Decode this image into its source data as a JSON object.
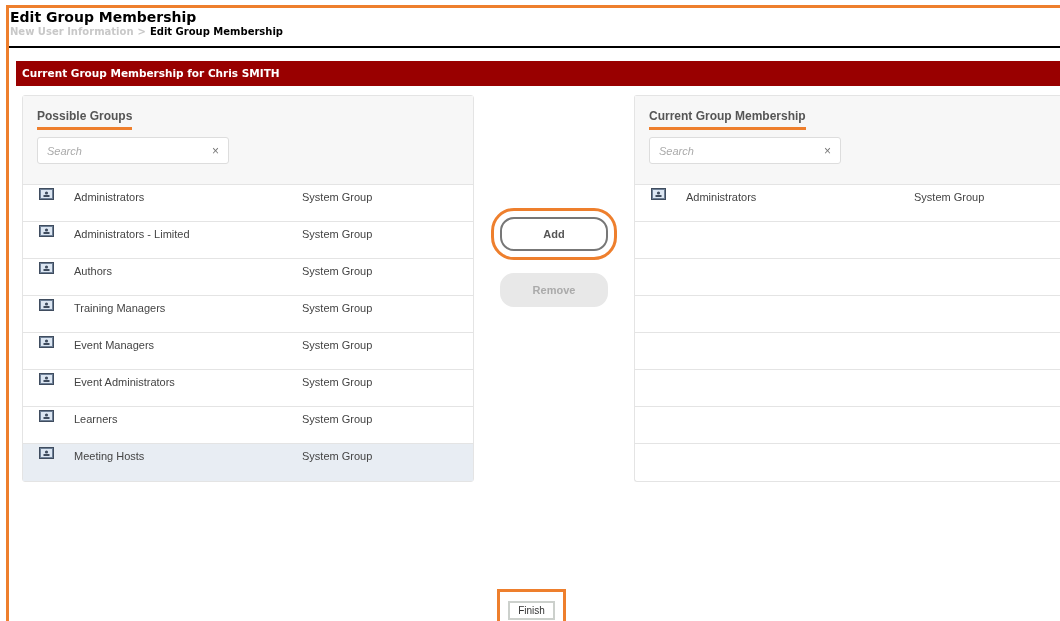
{
  "page": {
    "title": "Edit Group Membership",
    "breadcrumb": [
      {
        "label": "New User Information",
        "current": false
      },
      {
        "label": ">",
        "current": false
      },
      {
        "label": "Edit Group Membership",
        "current": true
      }
    ]
  },
  "banner": "Current Group Membership for Chris SMITH",
  "possible_groups": {
    "title": "Possible Groups",
    "underlined": true,
    "search": {
      "placeholder": "Search",
      "clear": "×"
    },
    "rows": [
      {
        "name": "Administrators",
        "type": "System Group",
        "selected": false
      },
      {
        "name": "Administrators - Limited",
        "type": "System Group",
        "selected": false
      },
      {
        "name": "Authors",
        "type": "System Group",
        "selected": false
      },
      {
        "name": "Training Managers",
        "type": "System Group",
        "selected": false
      },
      {
        "name": "Event Managers",
        "type": "System Group",
        "selected": false
      },
      {
        "name": "Event Administrators",
        "type": "System Group",
        "selected": false
      },
      {
        "name": "Learners",
        "type": "System Group",
        "selected": false
      },
      {
        "name": "Meeting Hosts",
        "type": "System Group",
        "selected": true
      }
    ]
  },
  "actions": [
    {
      "label": "Add",
      "disabled": false,
      "highlighted": true
    },
    {
      "label": "Remove",
      "disabled": true,
      "highlighted": false
    }
  ],
  "current_membership": {
    "title": "Current Group Membership",
    "underlined": true,
    "search": {
      "placeholder": "Search",
      "clear": "×"
    },
    "rows": [
      {
        "name": "Administrators",
        "type": "System Group",
        "selected": false
      }
    ]
  },
  "finish": {
    "label": "Finish",
    "highlighted": true
  }
}
